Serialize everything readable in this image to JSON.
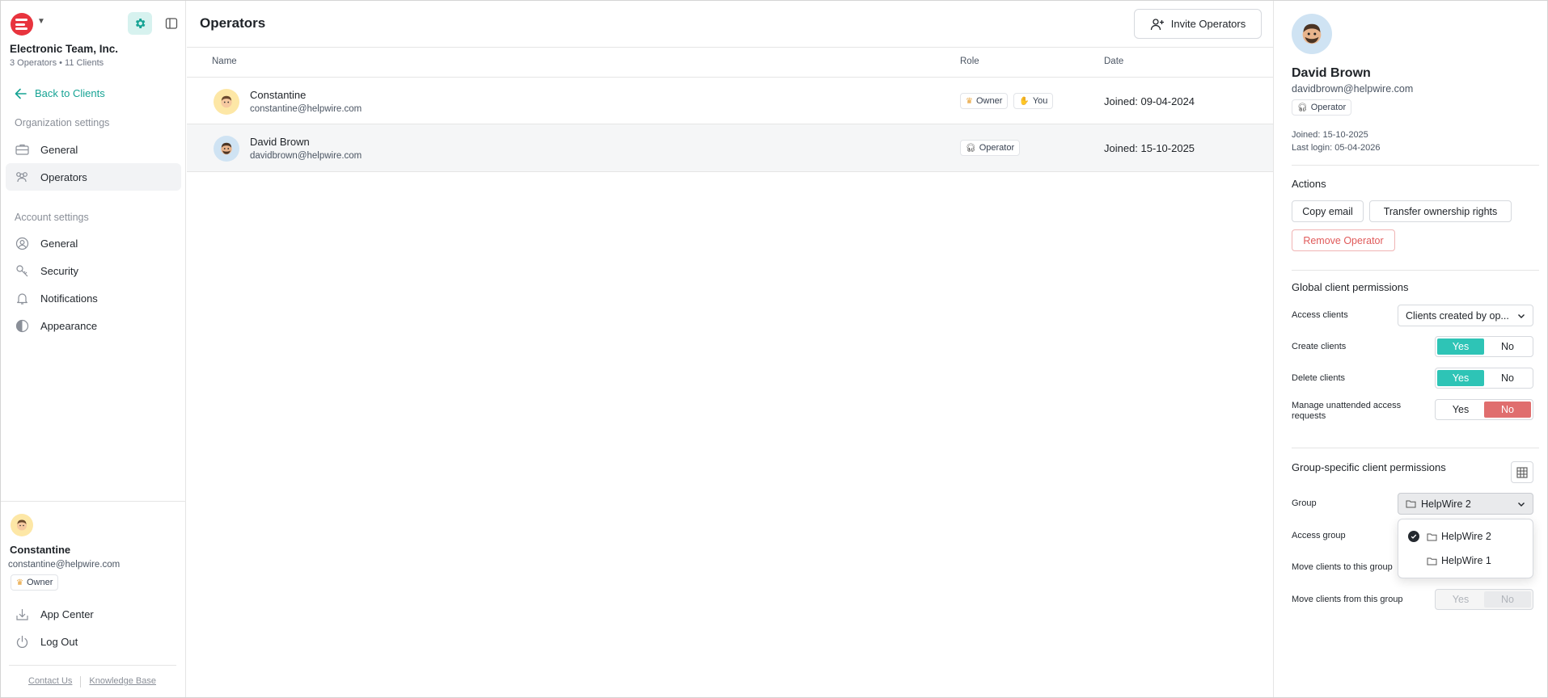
{
  "org": {
    "name": "Electronic Team, Inc.",
    "meta": "3 Operators • 11 Clients"
  },
  "sidebar": {
    "back_label": "Back to Clients",
    "org_section_title": "Organization settings",
    "org_items": [
      {
        "label": "General"
      },
      {
        "label": "Operators"
      }
    ],
    "account_section_title": "Account settings",
    "account_items": [
      {
        "label": "General"
      },
      {
        "label": "Security"
      },
      {
        "label": "Notifications"
      },
      {
        "label": "Appearance"
      }
    ],
    "user": {
      "name": "Constantine",
      "email": "constantine@helpwire.com",
      "role": "Owner"
    },
    "bottom_items": [
      {
        "label": "App Center"
      },
      {
        "label": "Log Out"
      }
    ],
    "footer": {
      "contact": "Contact Us",
      "kb": "Knowledge Base"
    }
  },
  "main": {
    "title": "Operators",
    "invite_label": "Invite Operators",
    "columns": {
      "name": "Name",
      "role": "Role",
      "date": "Date"
    },
    "rows": [
      {
        "name": "Constantine",
        "email": "constantine@helpwire.com",
        "role": "Owner",
        "you": "You",
        "date": "Joined: 09-04-2024"
      },
      {
        "name": "David Brown",
        "email": "davidbrown@helpwire.com",
        "role": "Operator",
        "date": "Joined: 15-10-2025"
      }
    ]
  },
  "panel": {
    "name": "David Brown",
    "email": "davidbrown@helpwire.com",
    "role": "Operator",
    "joined": "Joined: 15-10-2025",
    "last_login": "Last login: 05-04-2026",
    "actions_title": "Actions",
    "copy_email": "Copy email",
    "transfer": "Transfer ownership rights",
    "remove": "Remove Operator",
    "global_title": "Global client permissions",
    "access_clients_label": "Access clients",
    "access_clients_value": "Clients created by op...",
    "create_clients_label": "Create clients",
    "delete_clients_label": "Delete clients",
    "manage_label": "Manage unattended access requests",
    "yes": "Yes",
    "no": "No",
    "group_title": "Group-specific client permissions",
    "group_label": "Group",
    "group_value": "HelpWire 2",
    "access_group_label": "Access group",
    "move_to_label": "Move clients to this group",
    "move_from_label": "Move clients from this group",
    "group_options": [
      {
        "label": "HelpWire 2",
        "selected": true
      },
      {
        "label": "HelpWire 1",
        "selected": false
      }
    ]
  },
  "colors": {
    "accent": "#2ec4b6",
    "danger": "#e06e6e",
    "brand": "#e8343e"
  }
}
